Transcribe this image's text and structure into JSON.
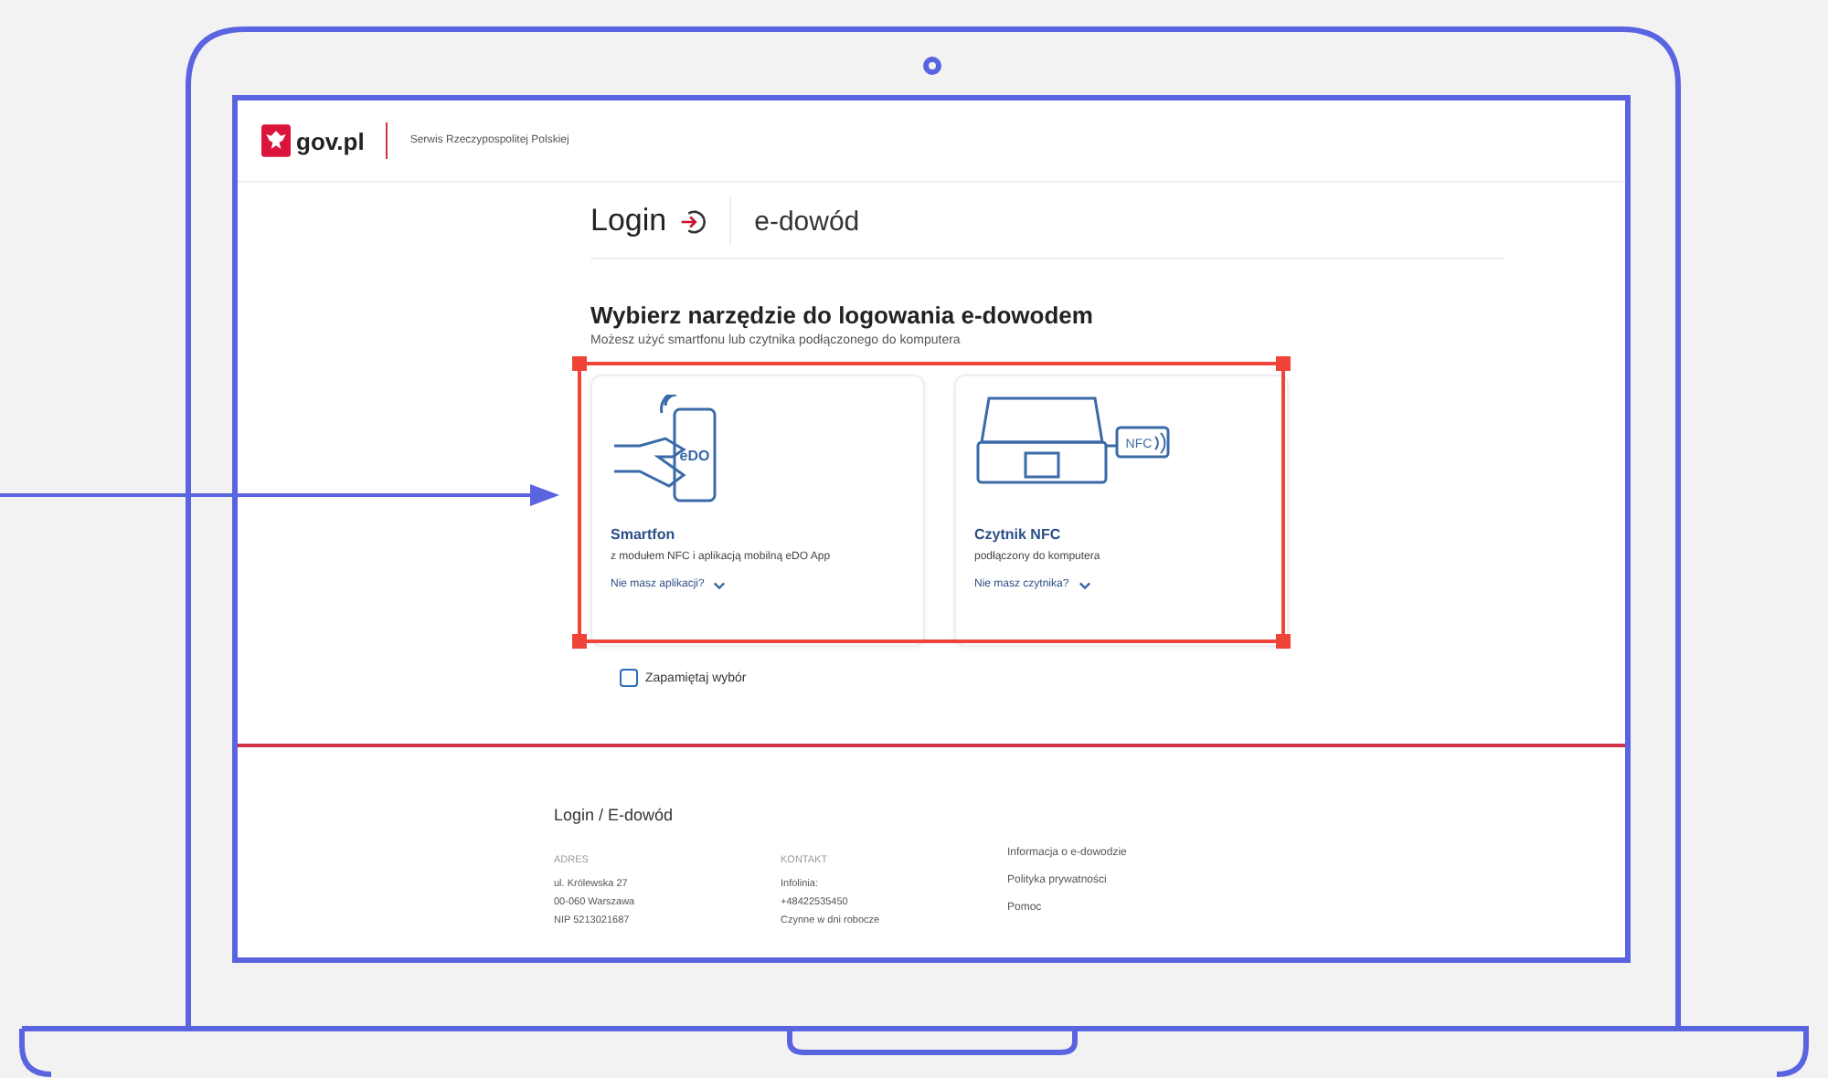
{
  "header": {
    "logo_text": "gov.pl",
    "tagline": "Serwis Rzeczypospolitej Polskiej"
  },
  "title_bar": {
    "title": "Login",
    "subtitle": "e-dowód"
  },
  "heading": "Wybierz narzędzie do logowania e-dowodem",
  "subheading": "Możesz użyć smartfonu lub czytnika podłączonego do komputera",
  "options": [
    {
      "kind": "phone",
      "title": "Smartfon",
      "description": "z modułem NFC i aplikacją mobilną eDO App",
      "link": "Nie masz aplikacji?",
      "badge": "eDO"
    },
    {
      "kind": "reader",
      "title": "Czytnik NFC",
      "description": "podłączony do komputera",
      "link": "Nie masz czytnika?",
      "badge": "NFC"
    }
  ],
  "remember": {
    "label": "Zapamiętaj wybór",
    "checked": false
  },
  "footer": {
    "title": "Login / E-dowód",
    "columns": [
      {
        "heading": "ADRES",
        "lines": [
          "ul. Królewska 27",
          "00-060 Warszawa",
          "NIP 5213021687"
        ]
      },
      {
        "heading": "KONTAKT",
        "lines": [
          "Infolinia:",
          "+48422535450",
          "Czynne w dni robocze"
        ]
      }
    ],
    "links": [
      "Informacja o e-dowodzie",
      "Polityka prywatności",
      "Pomoc"
    ]
  }
}
